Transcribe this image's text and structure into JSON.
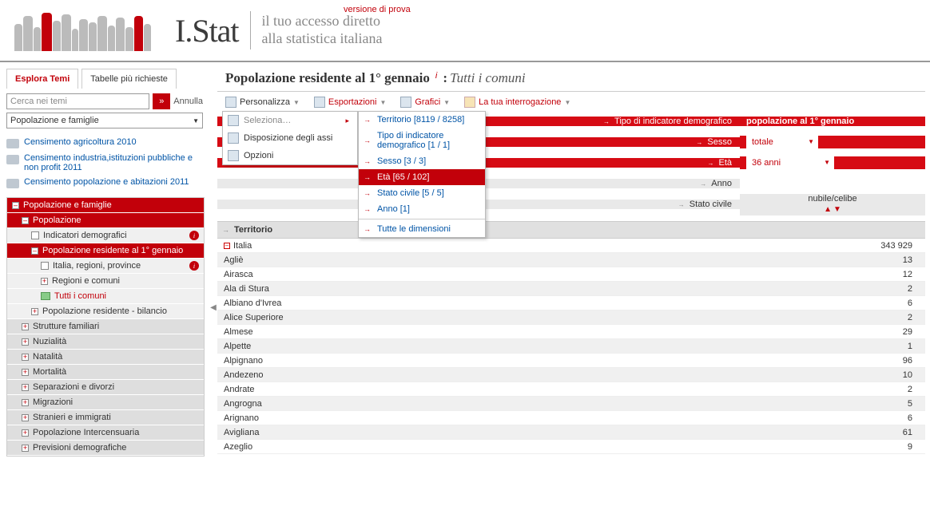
{
  "header": {
    "version": "versione di prova",
    "logo": "I.Stat",
    "tagline1": "il tuo accesso diretto",
    "tagline2": "alla statistica italiana"
  },
  "sidebar": {
    "tabs": {
      "explore": "Esplora Temi",
      "popular": "Tabelle più richieste"
    },
    "search_placeholder": "Cerca nei temi",
    "search_go": "»",
    "search_cancel": "Annulla",
    "theme_selected": "Popolazione e famiglie",
    "census": [
      "Censimento agricoltura 2010",
      "Censimento industria,istituzioni pubbliche e non profit 2011",
      "Censimento popolazione e abitazioni 2011"
    ],
    "tree": {
      "root": "Popolazione e famiglie",
      "pop": "Popolazione",
      "ind_demo": "Indicatori demografici",
      "pop_res": "Popolazione residente al 1° gennaio",
      "italia": "Italia, regioni, province",
      "regioni": "Regioni e comuni",
      "tutti": "Tutti i comuni",
      "bilancio": "Popolazione residente - bilancio",
      "branches": [
        "Strutture familiari",
        "Nuzialità",
        "Natalità",
        "Mortalità",
        "Separazioni e divorzi",
        "Migrazioni",
        "Stranieri e immigrati",
        "Popolazione Intercensuaria",
        "Previsioni demografiche"
      ]
    }
  },
  "main": {
    "title": "Popolazione residente al 1° gennaio",
    "title_sep": ":",
    "subtitle": "Tutti i comuni",
    "toolbar": {
      "personalize": "Personalizza",
      "export": "Esportazioni",
      "charts": "Grafici",
      "query": "La tua interrogazione"
    },
    "menu1": {
      "select": "Seleziona…",
      "layout": "Disposizione degli assi",
      "options": "Opzioni"
    },
    "menu2": [
      "Territorio [8119 / 8258]",
      "Tipo di indicatore demografico [1 / 1]",
      "Sesso [3 / 3]",
      "Età [65 / 102]",
      "Stato civile [5 / 5]",
      "Anno [1]",
      "Tutte le dimensioni"
    ],
    "filters": {
      "tipo_label": "Tipo di indicatore demografico",
      "tipo_value": "popolazione al 1° gennaio",
      "sesso_label": "Sesso",
      "sesso_value": "totale",
      "eta_label": "Età",
      "eta_value": "36 anni",
      "anno_label": "Anno",
      "stato_label": "Stato civile",
      "column_header": "nubile/celibe"
    },
    "territorio_label": "Territorio",
    "rows": [
      {
        "name": "Italia",
        "value": "343 929",
        "expand": true
      },
      {
        "name": "Agliè",
        "value": "13"
      },
      {
        "name": "Airasca",
        "value": "12"
      },
      {
        "name": "Ala di Stura",
        "value": "2"
      },
      {
        "name": "Albiano d'Ivrea",
        "value": "6"
      },
      {
        "name": "Alice Superiore",
        "value": "2"
      },
      {
        "name": "Almese",
        "value": "29"
      },
      {
        "name": "Alpette",
        "value": "1"
      },
      {
        "name": "Alpignano",
        "value": "96"
      },
      {
        "name": "Andezeno",
        "value": "10"
      },
      {
        "name": "Andrate",
        "value": "2"
      },
      {
        "name": "Angrogna",
        "value": "5"
      },
      {
        "name": "Arignano",
        "value": "6"
      },
      {
        "name": "Avigliana",
        "value": "61"
      },
      {
        "name": "Azeglio",
        "value": "9"
      }
    ]
  }
}
